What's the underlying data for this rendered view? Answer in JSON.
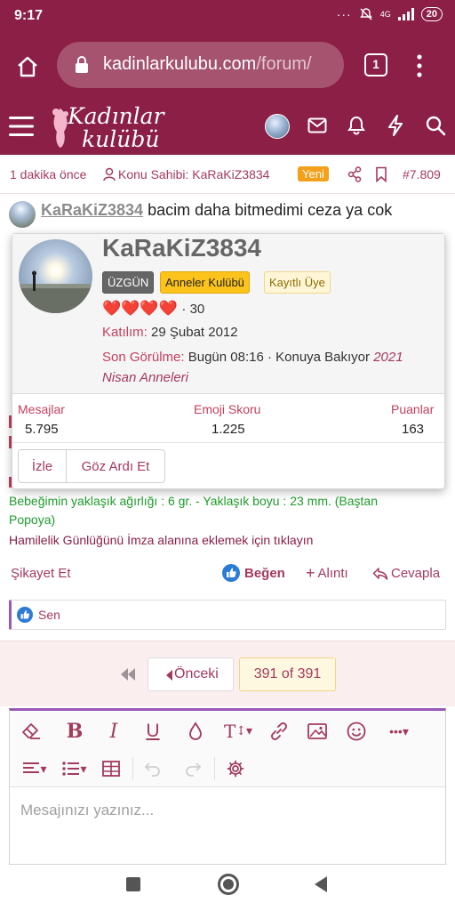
{
  "status": {
    "time": "9:17",
    "battery": "20"
  },
  "browser": {
    "url_main": "kadinlarkulubu.com",
    "url_tail": "/forum/",
    "tab_count": "1"
  },
  "site": {
    "logo_line1": "Kadınlar",
    "logo_line2": "kulübü"
  },
  "meta": {
    "time_ago": "1 dakika önce",
    "owner": "Konu Sahibi: KaRaKiZ3834",
    "new_badge": "Yeni",
    "post_number": "#7.809"
  },
  "post": {
    "username": "KaRaKiZ3834",
    "text": "bacim daha bitmedimi ceza ya cok"
  },
  "card": {
    "username": "KaRaKiZ3834",
    "tags": [
      "ÜZGÜN",
      "Anneler Kulübü",
      "Kayıtlı Üye"
    ],
    "hearts": "❤️❤️❤️❤️",
    "heart_count": "· 30",
    "joined_label": "Katılım:",
    "joined_value": "29 Şubat 2012",
    "lastseen_label": "Son Görülme:",
    "lastseen_value": "Bugün 08:16 · Konuya Bakıyor",
    "lastseen_group_1": "2021",
    "lastseen_group_2": "Nisan Anneleri",
    "stats": [
      {
        "label": "Mesajlar",
        "value": "5.795"
      },
      {
        "label": "Emoji Skoru",
        "value": "1.225"
      },
      {
        "label": "Puanlar",
        "value": "163"
      }
    ],
    "follow": "İzle",
    "ignore": "Göz Ardı Et"
  },
  "signature": {
    "line1": "Bebeğimin yaklaşık ağırlığı : 6 gr. - Yaklaşık boyu : 23 mm. (Baştan",
    "line2": "Popoya)",
    "line3": "Hamilelik Günlüğünü İmza alanına eklemek için tıklayın"
  },
  "post_actions": {
    "report": "Şikayet Et",
    "like": "Beğen",
    "quote": "Alıntı",
    "reply": "Cevapla"
  },
  "reactions": {
    "text": "Sen"
  },
  "pager": {
    "prev": "Önceki",
    "info": "391 of 391"
  },
  "editor": {
    "placeholder": "Mesajınızı yazınız..."
  },
  "colors": {
    "brand": "#8b1f45",
    "accent": "#a33a5c",
    "gold": "#fbc31c",
    "signature_green": "#1e9c2b"
  }
}
